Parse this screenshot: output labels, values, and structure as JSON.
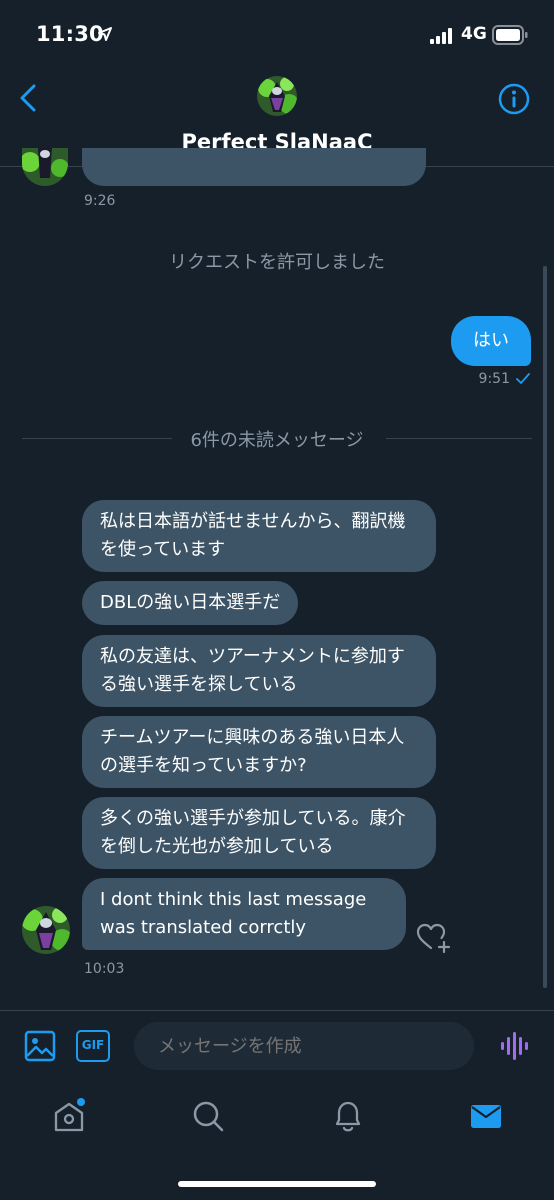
{
  "status_bar": {
    "time": "11:30",
    "network": "4G"
  },
  "header": {
    "title": "Perfect SlaNaaC"
  },
  "colors": {
    "background": "#15202b",
    "accent": "#1d9bf0",
    "incoming_bubble": "#3d5466",
    "muted_text": "#8b98a5"
  },
  "icons": {
    "back": "chevron-left-icon",
    "info": "info-icon",
    "image": "image-icon",
    "gif": "gif-icon",
    "voice": "voice-waveform-icon",
    "heart": "heart-plus-icon",
    "tab_home": "home-icon",
    "tab_search": "search-icon",
    "tab_notifications": "bell-icon",
    "tab_messages": "mail-icon"
  },
  "chat": {
    "prev_time": "9:26",
    "system_message": "リクエストを許可しました",
    "outgoing": {
      "text": "はい",
      "time": "9:51",
      "status_icon": "check-icon"
    },
    "unread_divider": "6件の未読メッセージ",
    "incoming_messages": [
      {
        "text": "私は日本語が話せませんから、翻訳機を使っています"
      },
      {
        "text": "DBLの強い日本選手だ"
      },
      {
        "text": "私の友達は、ツアーナメントに参加する強い選手を探している"
      },
      {
        "text": "チームツアーに興味のある強い日本人の選手を知っていますか?"
      },
      {
        "text": "多くの強い選手が参加している。康介を倒した光也が参加している"
      },
      {
        "text": "I dont think this last message was translated corrctly"
      }
    ],
    "last_time": "10:03"
  },
  "composer": {
    "gif_label": "GIF",
    "placeholder": "メッセージを作成"
  }
}
